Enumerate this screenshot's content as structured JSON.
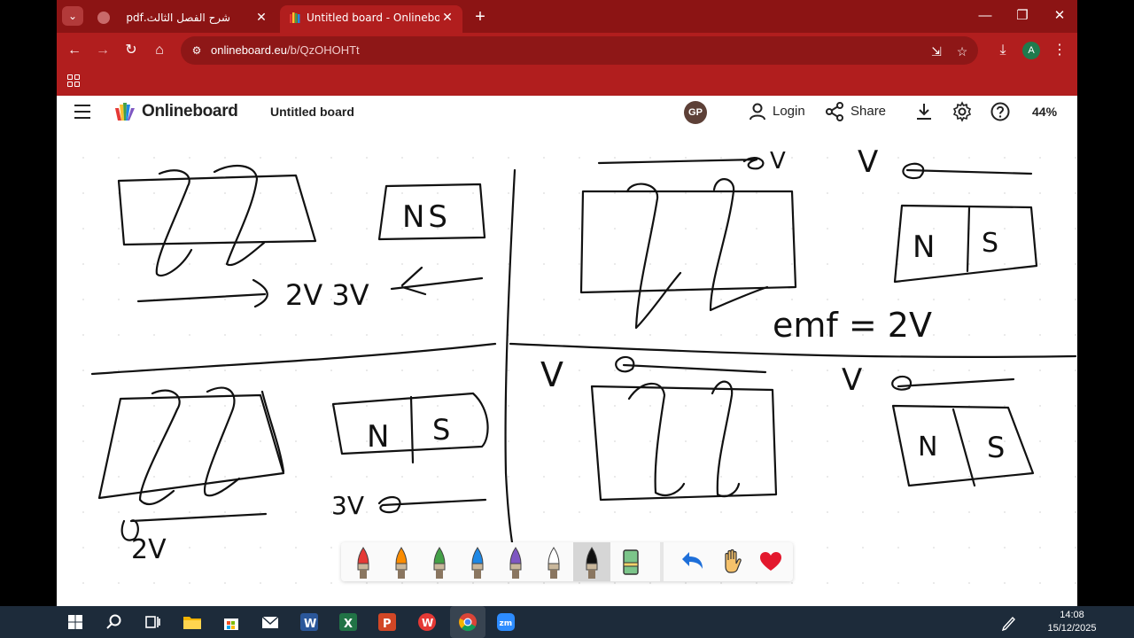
{
  "browser": {
    "tabs": [
      {
        "title": "شرح الفصل الثالث.pdf",
        "active": false
      },
      {
        "title": "Untitled board - Onlineboard",
        "active": true
      }
    ],
    "url_host": "onlineboard.eu",
    "url_path": "/b/QzOHOHTt",
    "profile_initial": "A"
  },
  "app": {
    "brand": "Onlineboard",
    "board_title": "Untitled board",
    "user_initials": "GP",
    "login_label": "Login",
    "share_label": "Share",
    "zoom": "44%"
  },
  "board_text": {
    "q1_magnet": "NS",
    "q1_labels": "2V  3V",
    "q2_top_label": "V",
    "q2_right_label": "V",
    "q2_magnet_n": "N",
    "q2_magnet_s": "S",
    "q2_emf": "emf = 2V",
    "q3_magnet_n": "N",
    "q3_magnet_s": "S",
    "q3_label_right": "3V",
    "q3_label_left": "2V",
    "q4_label_left": "V",
    "q4_label_right": "V",
    "q4_magnet_n": "N",
    "q4_magnet_s": "S"
  },
  "palette": {
    "colors": [
      "#e53935",
      "#fb8c00",
      "#43a047",
      "#1e88e5",
      "#7e57c2",
      "#ffffff",
      "#111111"
    ],
    "selected_color_index": 6,
    "tools": [
      "eraser-icon",
      "undo-icon",
      "hand-icon",
      "heart-icon"
    ]
  },
  "taskbar": {
    "time": "14:08",
    "date": "15/12/2025"
  }
}
